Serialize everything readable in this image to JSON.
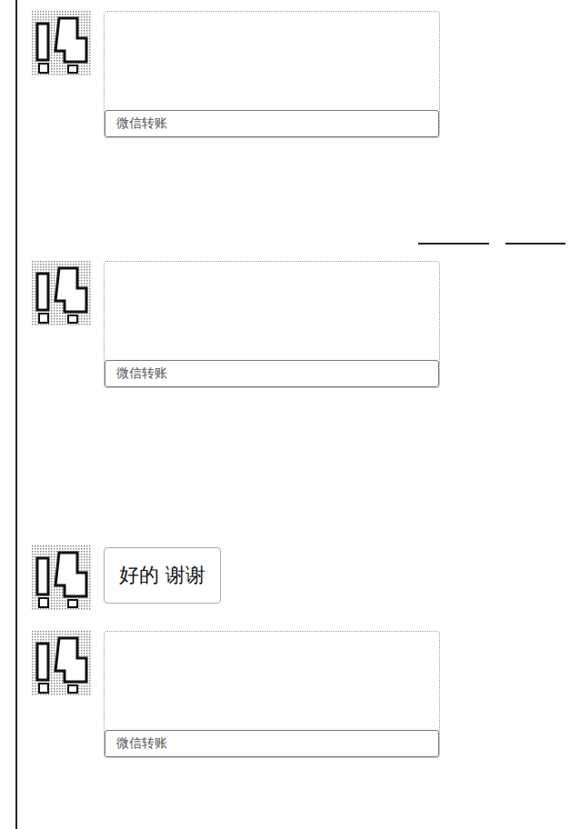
{
  "messages": [
    {
      "kind": "transfer",
      "label": "微信转账"
    },
    {
      "kind": "transfer",
      "label": "微信转账"
    },
    {
      "kind": "text",
      "text": "好的 谢谢"
    },
    {
      "kind": "transfer",
      "label": "微信转账"
    }
  ]
}
